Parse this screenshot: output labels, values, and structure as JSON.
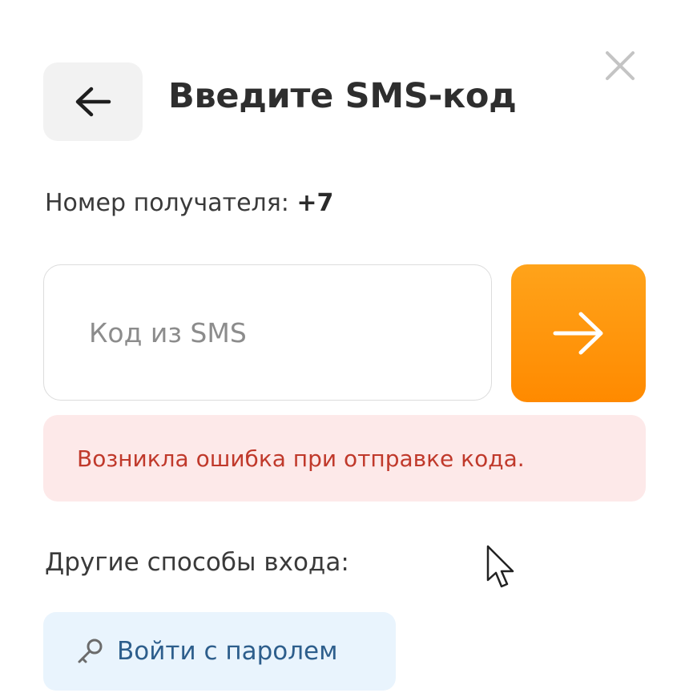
{
  "dialog": {
    "title": "Введите SMS-код",
    "recipient_label": "Номер получателя: ",
    "recipient_phone": "+7",
    "code_input": {
      "value": "",
      "placeholder": "Код из SMS"
    },
    "error_message": "Возникла ошибка при отправке кода.",
    "other_methods_label": "Другие способы входа:",
    "password_login_label": "Войти с паролем"
  },
  "icons": {
    "back": "arrow-left-icon",
    "close": "close-icon",
    "submit": "arrow-right-icon",
    "key": "key-icon"
  },
  "colors": {
    "accent": "#ff8a00",
    "error_bg": "#fde9e9",
    "error_text": "#c0392b",
    "link_bg": "#e9f4fd",
    "link_text": "#2d5e8c"
  }
}
